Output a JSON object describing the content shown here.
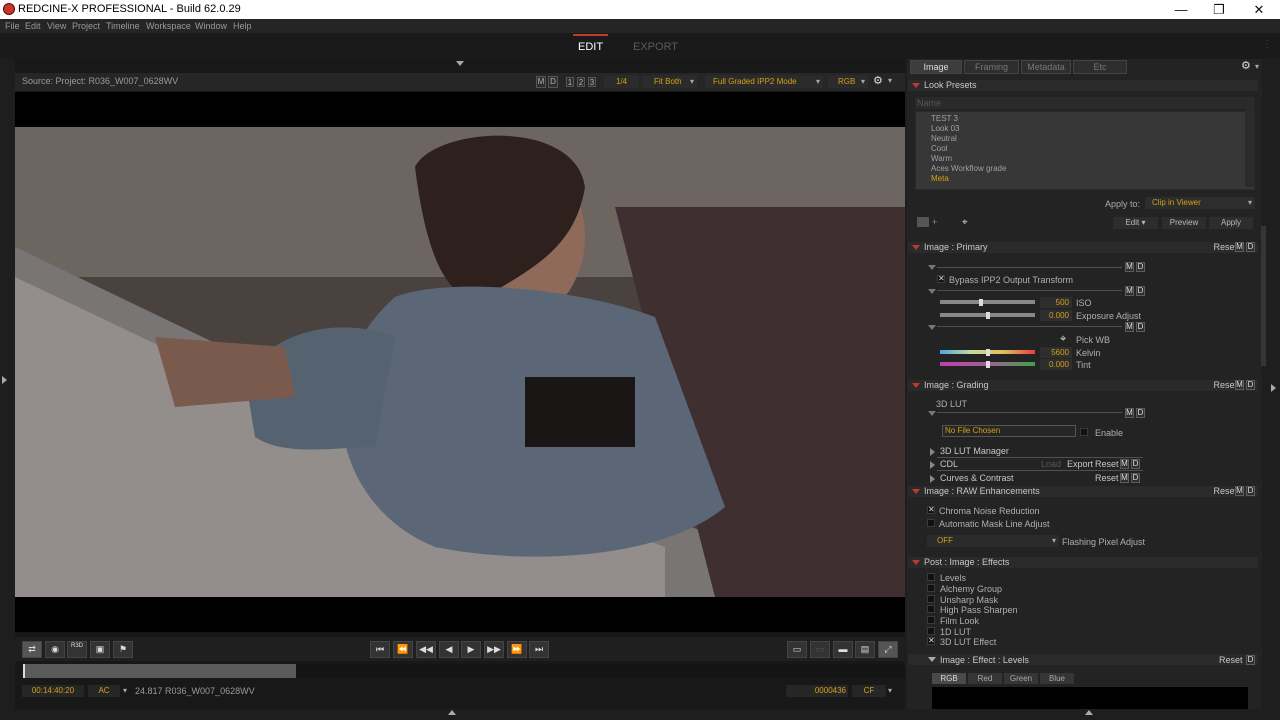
{
  "window": {
    "title": "REDCINE-X PROFESSIONAL - Build 62.0.29",
    "min": "—",
    "max": "❐",
    "close": "✕"
  },
  "menu": [
    "File",
    "Edit",
    "View",
    "Project",
    "Timeline",
    "Workspace",
    "Window",
    "Help"
  ],
  "modes": {
    "edit": "EDIT",
    "export": "EXPORT"
  },
  "viewer": {
    "source": "Source: Project: R036_W007_0628WV",
    "m": "M",
    "d": "D",
    "one": "1",
    "two": "2",
    "three": "3",
    "res": "1/4",
    "fit": "Fit Both",
    "mode": "Full Graded IPP2 Mode",
    "rgb": "RGB"
  },
  "status": {
    "timecode": "00:14:40:20",
    "ac": "AC",
    "clip_info": "24.817 R036_W007_0628WV",
    "frame": "0000436",
    "cf": "CF"
  },
  "transport_labels": {
    "r3d": "R3D"
  },
  "tabs": [
    "Image",
    "Framing",
    "Metadata",
    "Etc"
  ],
  "look_presets": {
    "title": "Look Presets",
    "name_placeholder": "Name",
    "items": [
      "TEST 3",
      "Look 03",
      "Neutral",
      "Cool",
      "Warm",
      "Aces Workflow grade",
      "Meta"
    ],
    "apply_to_label": "Apply to:",
    "apply_to_value": "Clip in Viewer",
    "edit": "Edit",
    "preview": "Preview",
    "apply": "Apply"
  },
  "primary": {
    "title": "Image : Primary",
    "reset": "Reset",
    "bypass": "Bypass IPP2 Output Transform",
    "iso_value": "500",
    "iso_label": "ISO",
    "exposure_value": "0.000",
    "exposure_label": "Exposure Adjust",
    "pick_wb": "Pick WB",
    "kelvin_value": "5600",
    "kelvin_label": "Kelvin",
    "tint_value": "0.000",
    "tint_label": "Tint"
  },
  "grading": {
    "title": "Image : Grading",
    "reset": "Reset",
    "lut": "3D LUT",
    "no_file": "No File Chosen",
    "enable": "Enable",
    "lut_manager": "3D LUT Manager",
    "cdl": "CDL",
    "load": "Load",
    "export": "Export",
    "cdl_reset": "Reset",
    "curves": "Curves & Contrast",
    "curves_reset": "Reset"
  },
  "raw": {
    "title": "Image : RAW Enhancements",
    "reset": "Reset",
    "chroma": "Chroma Noise Reduction",
    "mask": "Automatic Mask Line Adjust",
    "flash_value": "OFF",
    "flash_label": "Flashing Pixel Adjust"
  },
  "effects": {
    "title": "Post : Image : Effects",
    "items": [
      "Levels",
      "Alchemy Group",
      "Unsharp Mask",
      "High Pass Sharpen",
      "Film Look",
      "1D LUT",
      "3D LUT Effect"
    ]
  },
  "levels": {
    "title": "Image : Effect : Levels",
    "reset": "Reset",
    "d": "D",
    "tabs": [
      "RGB",
      "Red",
      "Green",
      "Blue"
    ]
  },
  "colors": {
    "accent": "#c0392b",
    "value": "#d4a017"
  }
}
